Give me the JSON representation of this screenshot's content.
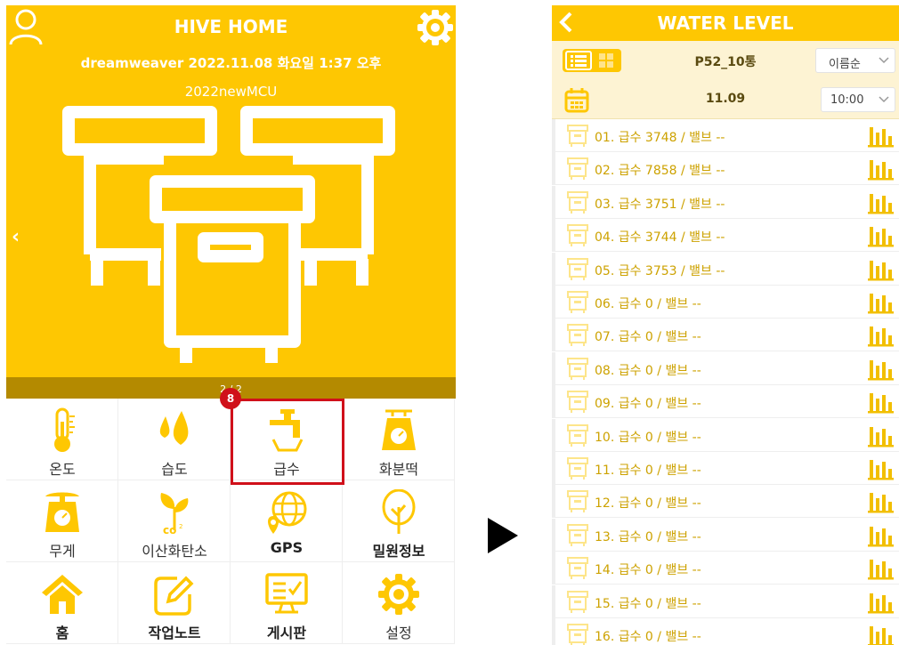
{
  "left": {
    "title": "HIVE HOME",
    "subtitle": "dreamweaver 2022.11.08 화요일 1:37 오후",
    "device_name": "2022newMCU",
    "pager": "2 / 2",
    "badge": "8",
    "menu": [
      {
        "label": "온도",
        "icon": "thermometer-icon",
        "bold": false
      },
      {
        "label": "습도",
        "icon": "water-drops-icon",
        "bold": false
      },
      {
        "label": "급수",
        "icon": "faucet-icon",
        "bold": false
      },
      {
        "label": "화분떡",
        "icon": "scale-icon",
        "bold": false
      },
      {
        "label": "무게",
        "icon": "weight-scale-icon",
        "bold": false
      },
      {
        "label": "이산화탄소",
        "icon": "co2-plant-icon",
        "bold": false
      },
      {
        "label": "GPS",
        "icon": "gps-globe-icon",
        "bold": true
      },
      {
        "label": "밀원정보",
        "icon": "tree-icon",
        "bold": true
      },
      {
        "label": "홈",
        "icon": "home-icon",
        "bold": true
      },
      {
        "label": "작업노트",
        "icon": "edit-note-icon",
        "bold": true
      },
      {
        "label": "게시판",
        "icon": "board-monitor-icon",
        "bold": true
      },
      {
        "label": "설정",
        "icon": "gear-icon",
        "bold": false
      }
    ]
  },
  "right": {
    "title": "WATER LEVEL",
    "hive_name": "P52_10통",
    "sort_select": "이름순",
    "date": "11.09",
    "time_select": "10:00",
    "rows": [
      "01. 급수 3748 / 밸브 --",
      "02. 급수 7858 / 밸브 --",
      "03. 급수 3751 / 밸브 --",
      "04. 급수 3744 / 밸브 --",
      "05. 급수 3753 / 밸브 --",
      "06. 급수 0 / 밸브 --",
      "07. 급수 0 / 밸브 --",
      "08. 급수 0 / 밸브 --",
      "09. 급수 0 / 밸브 --",
      "10. 급수 0 / 밸브 --",
      "11. 급수 0 / 밸브 --",
      "12. 급수 0 / 밸브 --",
      "13. 급수 0 / 밸브 --",
      "14. 급수 0 / 밸브 --",
      "15. 급수 0 / 밸브 --",
      "16. 급수 0 / 밸브 --"
    ]
  },
  "colors": {
    "accent": "#fec702",
    "dark_accent": "#b48a00",
    "highlight": "#d0101a",
    "row_text": "#cda200"
  }
}
